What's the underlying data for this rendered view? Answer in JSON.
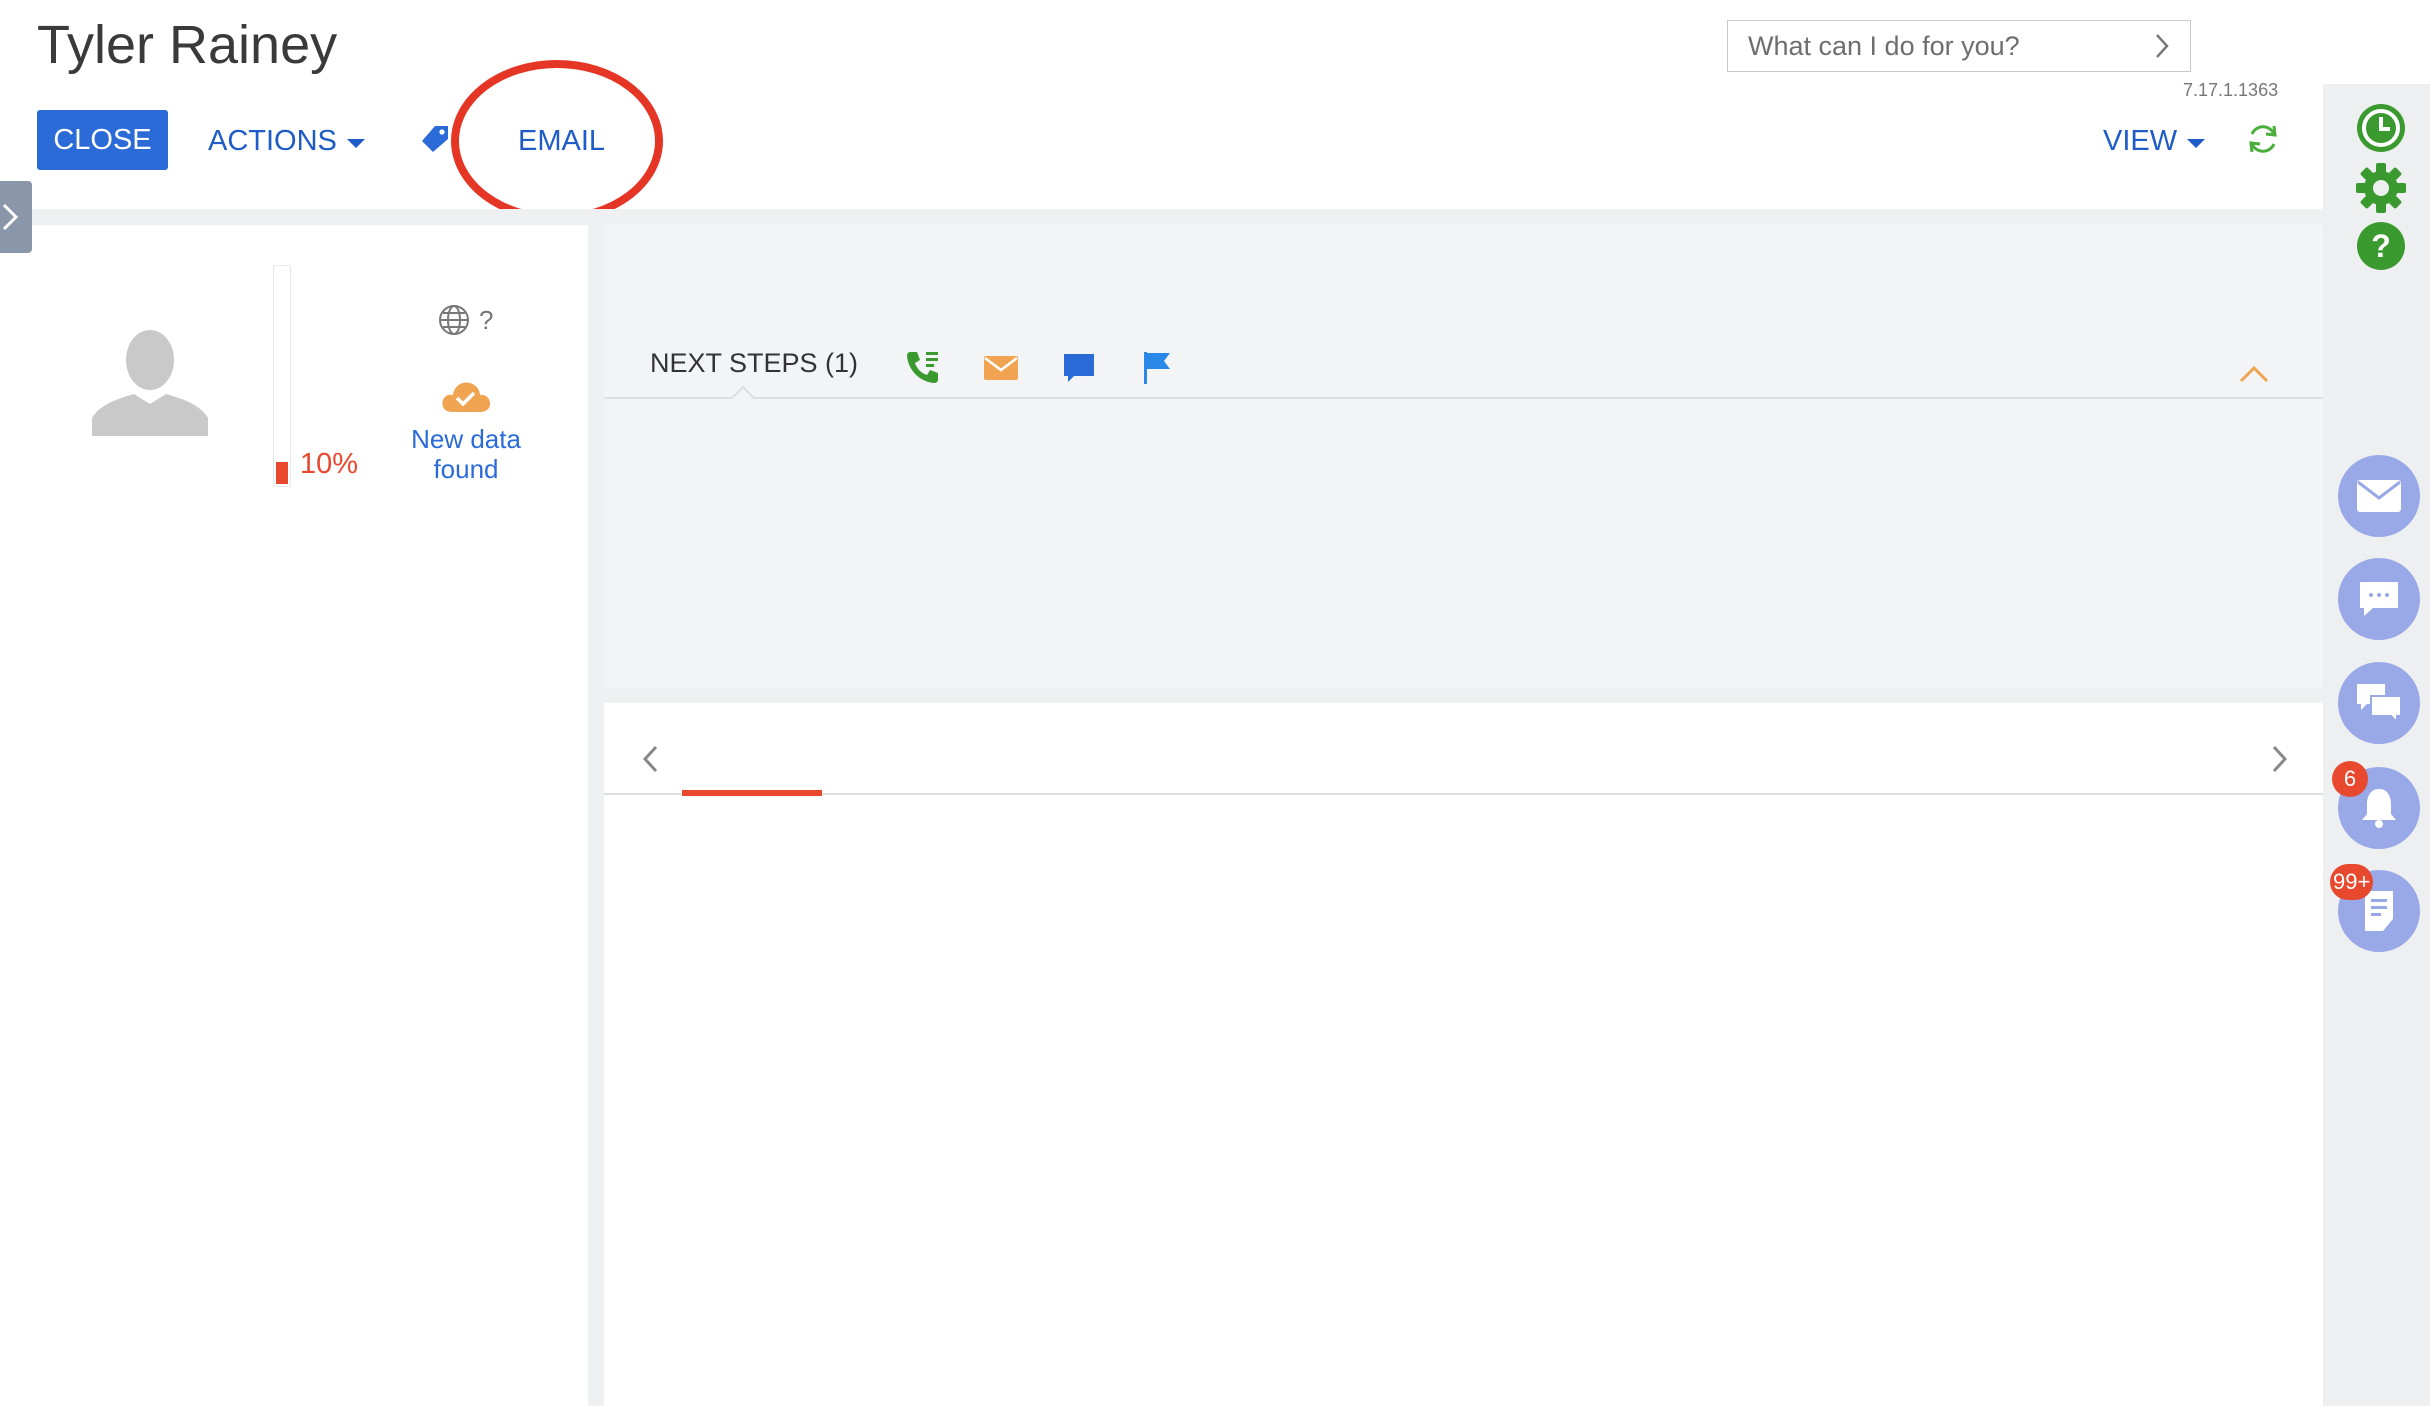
{
  "header": {
    "title": "Tyler Rainey",
    "close_label": "CLOSE",
    "actions_label": "ACTIONS",
    "email_label": "EMAIL",
    "view_label": "VIEW",
    "search_placeholder": "What can I do for you?",
    "version": "7.17.1.1363"
  },
  "profile": {
    "completeness": "10%",
    "completeness_value": 0.1,
    "web_status": "?",
    "new_data_label": "New data found"
  },
  "next_steps": {
    "title": "NEXT STEPS (1)",
    "icons": [
      "call-icon",
      "email-icon",
      "chat-icon",
      "flag-icon"
    ]
  },
  "rail": {
    "notifications_badge": "6",
    "feed_badge": "99+",
    "icons": [
      "clock-icon",
      "gear-icon",
      "help-icon",
      "mail-icon",
      "comment-icon",
      "chat-icon",
      "bell-icon",
      "feed-icon"
    ]
  },
  "colors": {
    "primary": "#2a6bd8",
    "accent_red": "#e8492e",
    "green": "#3b9a2f",
    "orange": "#f0a451",
    "rail_circle": "#99a8e6"
  }
}
